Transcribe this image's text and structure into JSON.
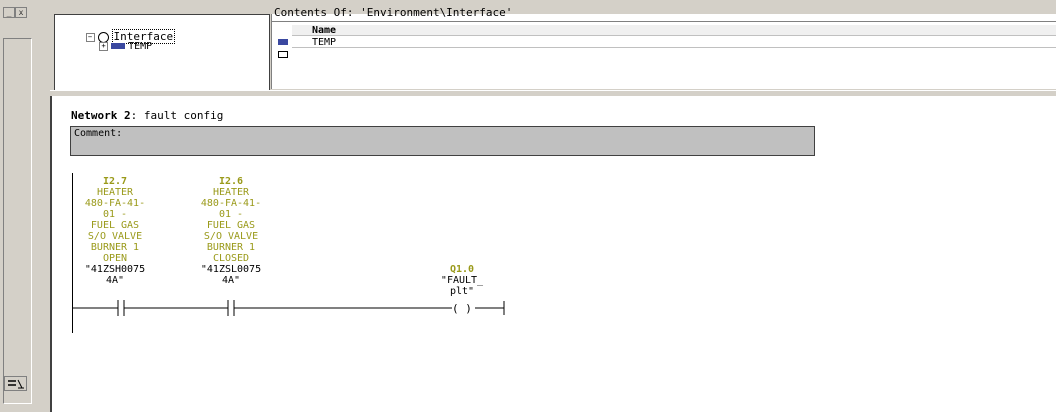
{
  "interface": {
    "contents_title": "Contents Of: 'Environment\\Interface'",
    "tree_root": "Interface",
    "tree_child": "TEMP",
    "name_header": "Name",
    "name_rows": [
      "TEMP"
    ]
  },
  "left": {
    "min_label": "_",
    "close_label": "x"
  },
  "network": {
    "title_prefix": "Network 2",
    "title_sep": ":",
    "title_text": "fault config",
    "comment_label": "Comment:"
  },
  "contacts": [
    {
      "address": "I2.7",
      "desc_lines": [
        "HEATER",
        "480-FA-41-",
        "01  -",
        "FUEL GAS",
        "S/O VALVE",
        "BURNER 1",
        "OPEN"
      ],
      "symbol_lines": [
        "\"41ZSH0075",
        "4A\""
      ]
    },
    {
      "address": "I2.6",
      "desc_lines": [
        "HEATER",
        "480-FA-41-",
        "01  -",
        "FUEL GAS",
        "S/O VALVE",
        "BURNER 1",
        "CLOSED"
      ],
      "symbol_lines": [
        "\"41ZSL0075",
        "4A\""
      ]
    }
  ],
  "coil": {
    "address": "Q1.0",
    "symbol_lines": [
      "\"FAULT_",
      "plt\""
    ],
    "glyph": "( )"
  },
  "colors": {
    "panel": "#d4d0c8",
    "olive": "#9a9a1a",
    "comment_bg": "#c0c0c0"
  }
}
